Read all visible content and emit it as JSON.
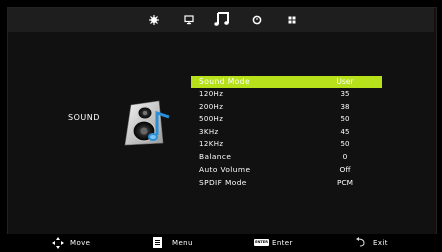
{
  "tabs": [
    {
      "icon": "picture-icon",
      "active": false
    },
    {
      "icon": "monitor-icon",
      "active": false
    },
    {
      "icon": "music-note-icon",
      "active": true
    },
    {
      "icon": "clock-icon",
      "active": false
    },
    {
      "icon": "grid-icon",
      "active": false
    }
  ],
  "section": {
    "label": "SOUND",
    "icon": "speaker-icon"
  },
  "menu": {
    "selected": {
      "label": "Sound Mode",
      "value": "User"
    },
    "bands": [
      {
        "label": "120Hz",
        "value": "35"
      },
      {
        "label": "200Hz",
        "value": "38"
      },
      {
        "label": "500Hz",
        "value": "50"
      },
      {
        "label": "3KHz",
        "value": "45"
      },
      {
        "label": "12KHz",
        "value": "50"
      }
    ],
    "items": [
      {
        "label": "Balance",
        "value": "0"
      },
      {
        "label": "Auto Volume",
        "value": "Off"
      },
      {
        "label": "SPDIF Mode",
        "value": "PCM"
      }
    ]
  },
  "hints": {
    "move": "Move",
    "menu": "Menu",
    "enter_key": "ENTER",
    "enter": "Enter",
    "exit": "Exit"
  },
  "colors": {
    "highlight": "#b6e11b",
    "background": "#111111"
  }
}
